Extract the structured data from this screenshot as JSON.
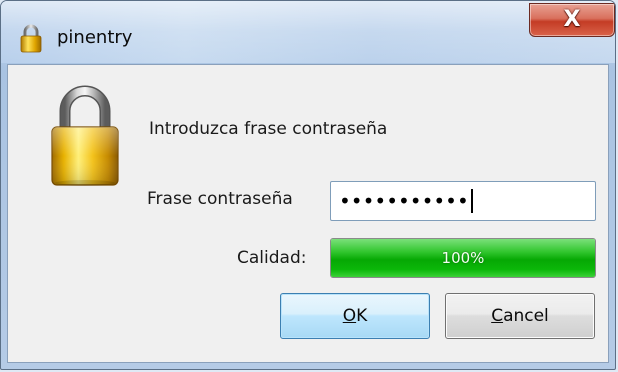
{
  "window": {
    "title": "pinentry",
    "close_label": "X"
  },
  "dialog": {
    "prompt": "Introduzca frase contraseña",
    "passphrase_label": "Frase contraseña",
    "passphrase_masked": "•••••••••••",
    "quality_label": "Calidad:",
    "quality_text": "100%",
    "quality_value": 1.0
  },
  "buttons": {
    "ok_accel": "O",
    "ok_rest": "K",
    "cancel_accel": "C",
    "cancel_rest": "ancel"
  },
  "icons": {
    "title": "lock-icon",
    "main": "padlock-icon"
  },
  "colors": {
    "quality_fill": "#06a804",
    "close_button": "#c43c25",
    "ok_border": "#3c7fb1"
  }
}
